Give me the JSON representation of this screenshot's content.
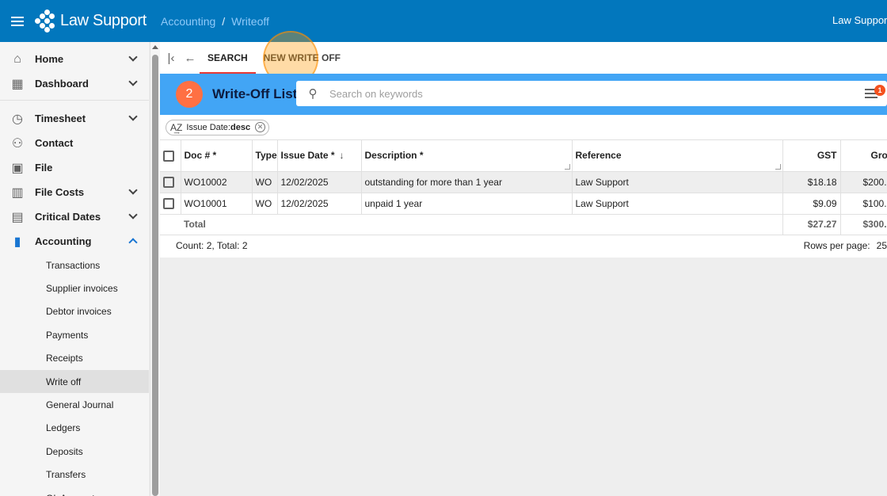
{
  "app": {
    "brand": "Law Support",
    "breadcrumb": [
      "Accounting",
      "Writeoff"
    ],
    "breadcrumb_sep": "/",
    "user_label": "Law Support"
  },
  "sidebar": {
    "items": [
      {
        "label": "Home",
        "icon": "home-icon",
        "expandable": true
      },
      {
        "label": "Dashboard",
        "icon": "dashboard-icon",
        "expandable": true
      },
      {
        "label": "Timesheet",
        "icon": "timer-icon",
        "expandable": true
      },
      {
        "label": "Contact",
        "icon": "people-icon",
        "expandable": false
      },
      {
        "label": "File",
        "icon": "briefcase-icon",
        "expandable": false
      },
      {
        "label": "File Costs",
        "icon": "building-icon",
        "expandable": true
      },
      {
        "label": "Critical Dates",
        "icon": "calendar-icon",
        "expandable": true
      },
      {
        "label": "Accounting",
        "icon": "bar-chart-icon",
        "expandable": true,
        "expanded": true
      }
    ],
    "accounting_sub": [
      "Transactions",
      "Supplier invoices",
      "Debtor invoices",
      "Payments",
      "Receipts",
      "Write off",
      "General Journal",
      "Ledgers",
      "Deposits",
      "Transfers",
      "GL Accounts"
    ],
    "selected_sub": "Write off"
  },
  "tabs": {
    "search": "SEARCH",
    "new": "NEW WRITE OFF"
  },
  "list": {
    "step": "2",
    "title": "Write-Off List",
    "search_placeholder": "Search on keywords",
    "filter_count": "1",
    "sort_chip": {
      "label": "Issue Date:",
      "value": "desc"
    }
  },
  "table": {
    "headers": {
      "doc": "Doc # *",
      "type": "Type",
      "issue_date": "Issue Date *",
      "description": "Description *",
      "reference": "Reference",
      "gst": "GST",
      "gross": "Gro"
    },
    "rows": [
      {
        "doc": "WO10002",
        "type": "WO",
        "issue_date": "12/02/2025",
        "description": "outstanding for more than 1 year",
        "reference": "Law Support",
        "gst": "$18.18",
        "gross": "$200."
      },
      {
        "doc": "WO10001",
        "type": "WO",
        "issue_date": "12/02/2025",
        "description": "unpaid 1 year",
        "reference": "Law Support",
        "gst": "$9.09",
        "gross": "$100."
      }
    ],
    "total": {
      "label": "Total",
      "gst": "$27.27",
      "gross": "$300."
    }
  },
  "footer": {
    "count": "Count: 2, Total: 2",
    "rows_per_page_label": "Rows per page:",
    "rows_per_page_value": "25"
  },
  "colors": {
    "app_bar": "#0277bd",
    "list_header": "#42a5f5",
    "badge": "#ff7043",
    "tab_underline": "#e53935"
  }
}
